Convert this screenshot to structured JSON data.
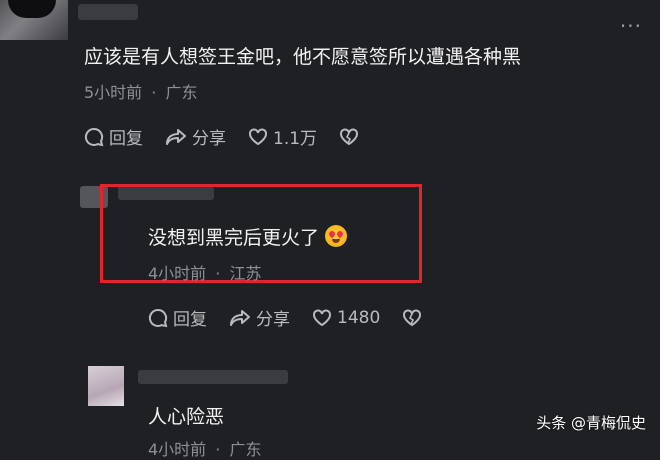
{
  "comments": [
    {
      "text": "应该是有人想签王金吧，他不愿意签所以遭遇各种黑",
      "time": "5小时前",
      "location": "广东",
      "reply_label": "回复",
      "share_label": "分享",
      "likes": "1.1万"
    },
    {
      "text": "没想到黑完后更火了",
      "emoji": "heart-eyes-emoji",
      "time": "4小时前",
      "location": "江苏",
      "reply_label": "回复",
      "share_label": "分享",
      "likes": "1480"
    },
    {
      "text": "人心险恶",
      "time": "4小时前",
      "location": "广东"
    }
  ],
  "separator": "·",
  "more_label": "···",
  "watermark": "头条 @青梅侃史",
  "colors": {
    "background": "#1f2023",
    "highlight_box": "#e4242b",
    "meta_text": "#8e8f94"
  }
}
